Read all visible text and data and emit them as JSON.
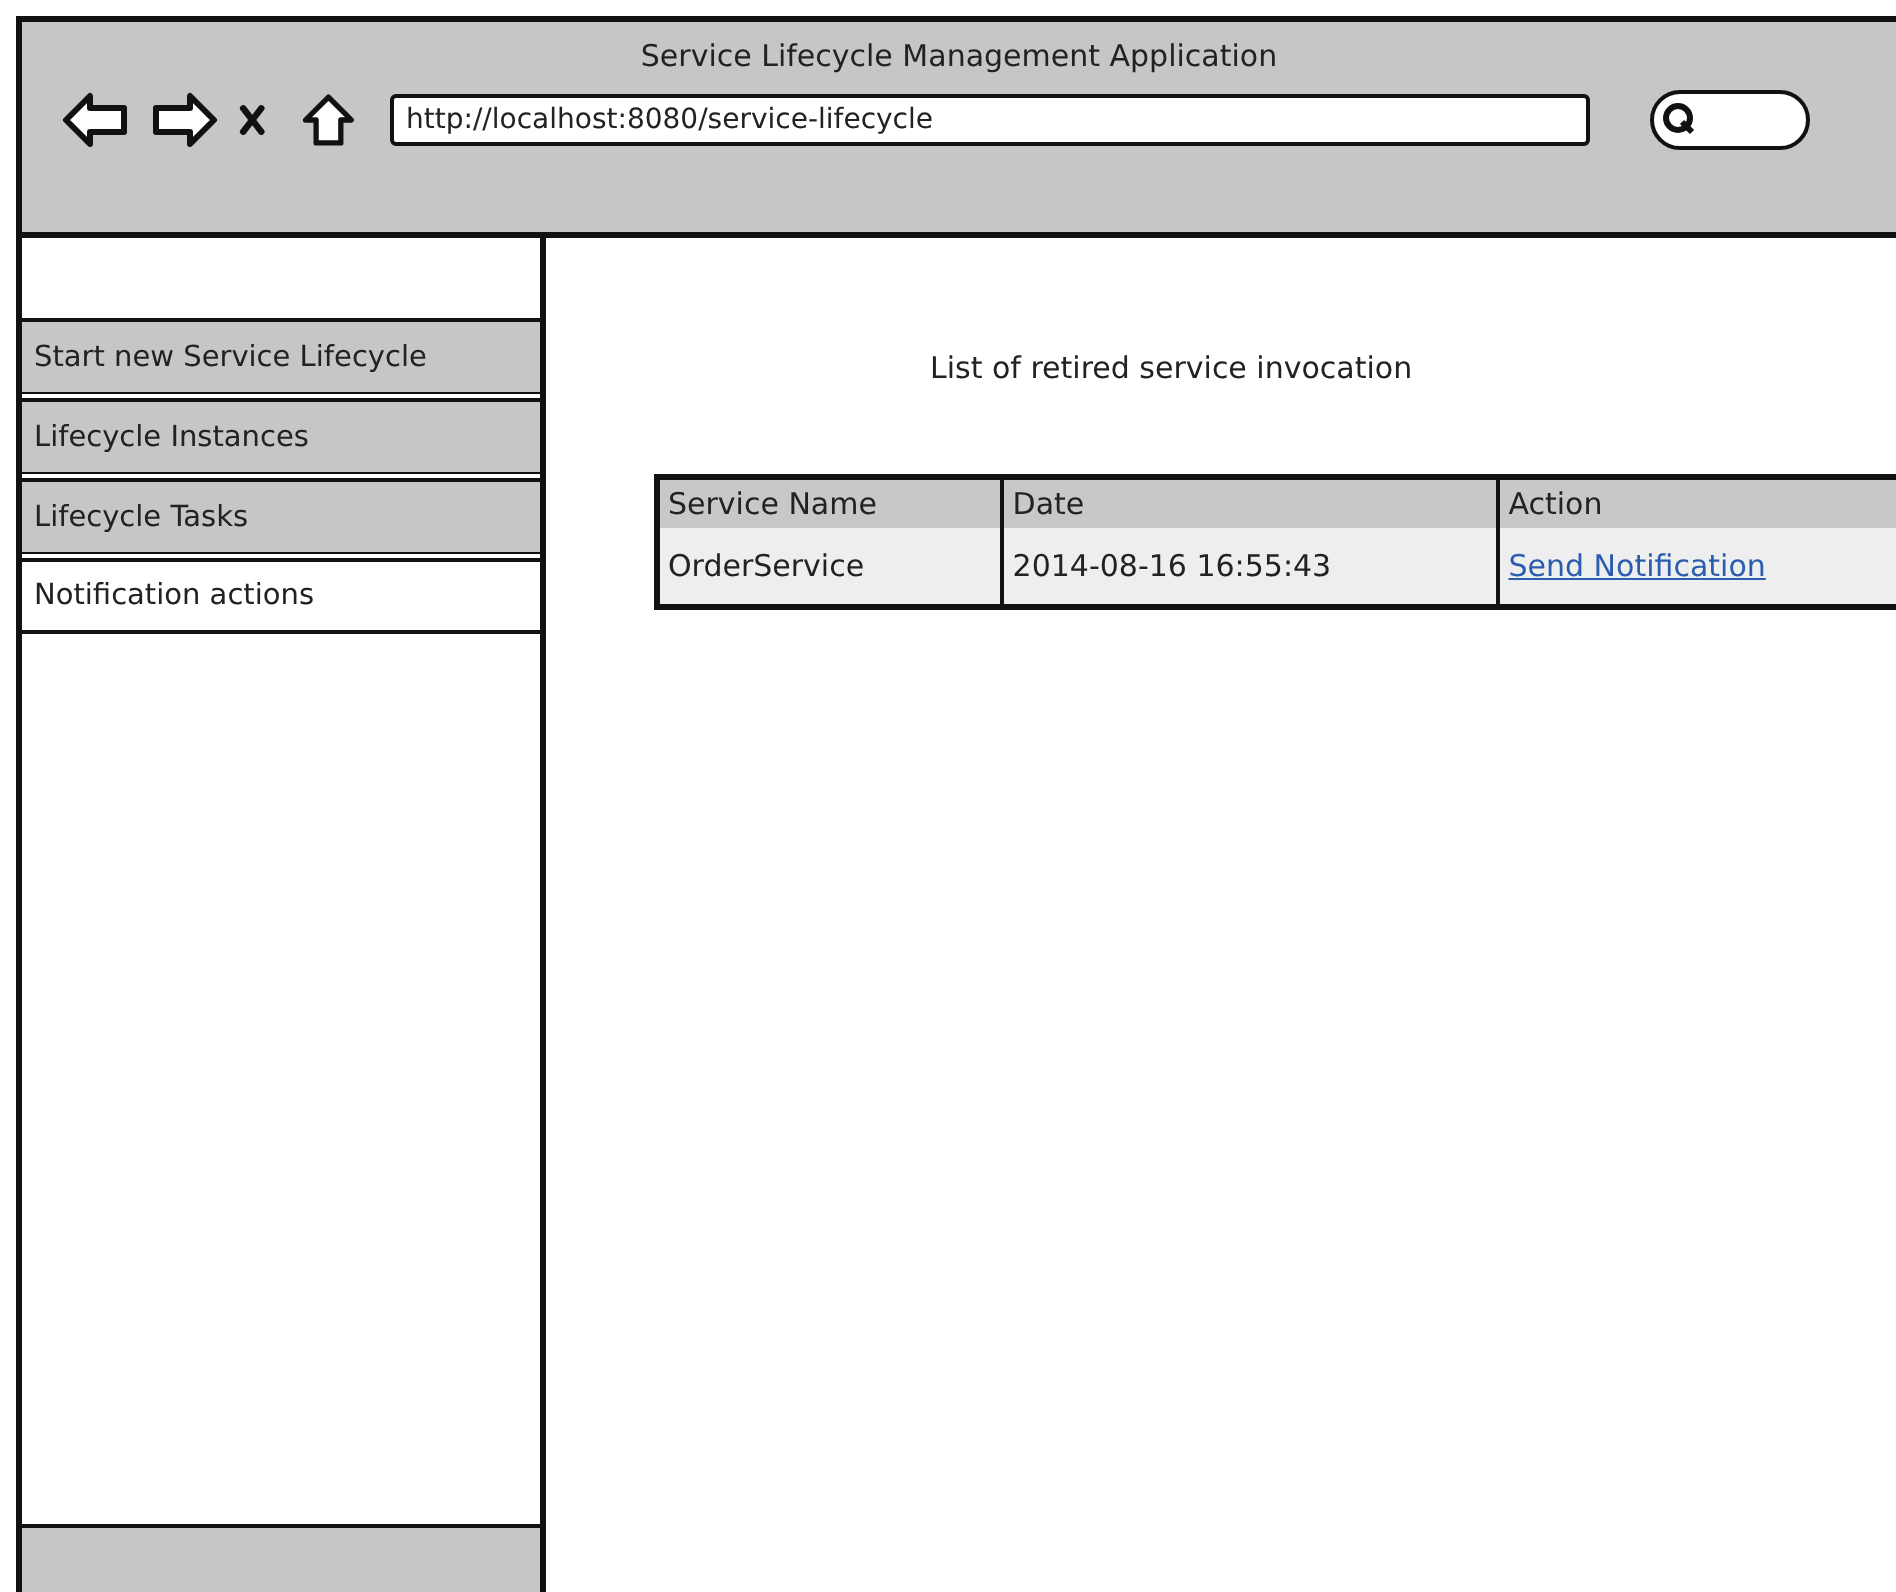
{
  "window": {
    "title": "Service Lifecycle Management Application",
    "address": "http://localhost:8080/service-lifecycle"
  },
  "sidebar": {
    "items": [
      {
        "label": "Start new Service Lifecycle",
        "selected": false
      },
      {
        "label": "Lifecycle Instances",
        "selected": false
      },
      {
        "label": "Lifecycle Tasks",
        "selected": false
      },
      {
        "label": "Notification actions",
        "selected": true
      }
    ]
  },
  "content": {
    "heading": "List of retired service invocation",
    "table": {
      "columns": [
        "Service Name",
        "Date",
        "Action"
      ],
      "rows": [
        {
          "service_name": "OrderService",
          "date": "2014-08-16 16:55:43",
          "action": "Send Notification"
        }
      ]
    }
  }
}
